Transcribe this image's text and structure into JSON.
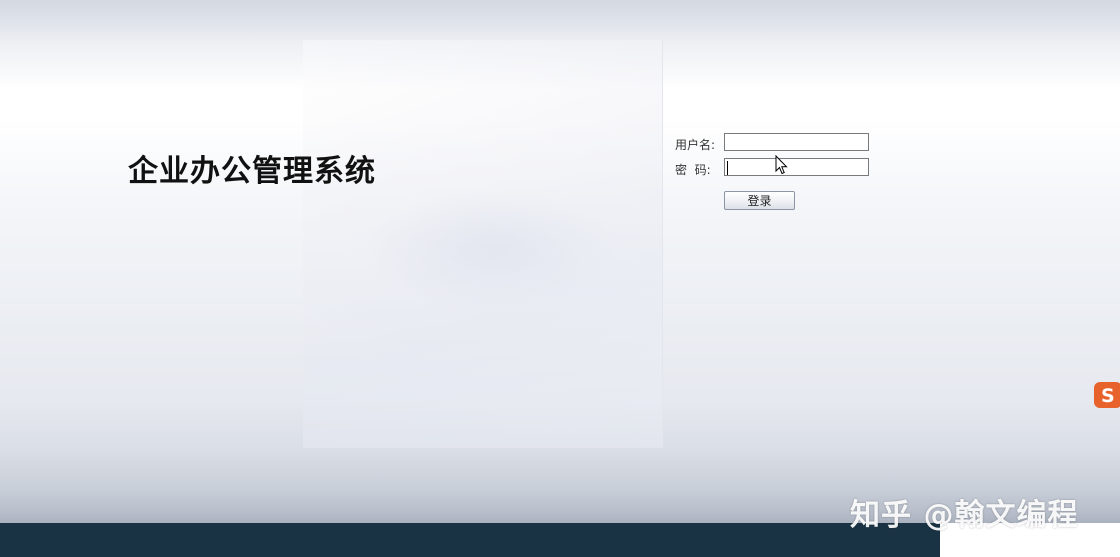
{
  "header": {
    "system_title": "企业办公管理系统"
  },
  "login": {
    "username_label": "用户名:",
    "password_label": "密  码:",
    "username_value": "",
    "password_value": "",
    "submit_label": "登录"
  },
  "overlay": {
    "watermark": "知乎 @翰文编程",
    "ime_glyph": "S"
  },
  "colors": {
    "footer_bar": "#1a3344",
    "ime_orange": "#e8622c"
  },
  "icons": {
    "cursor": "mouse-pointer-icon",
    "ime": "sogou-ime-icon"
  }
}
